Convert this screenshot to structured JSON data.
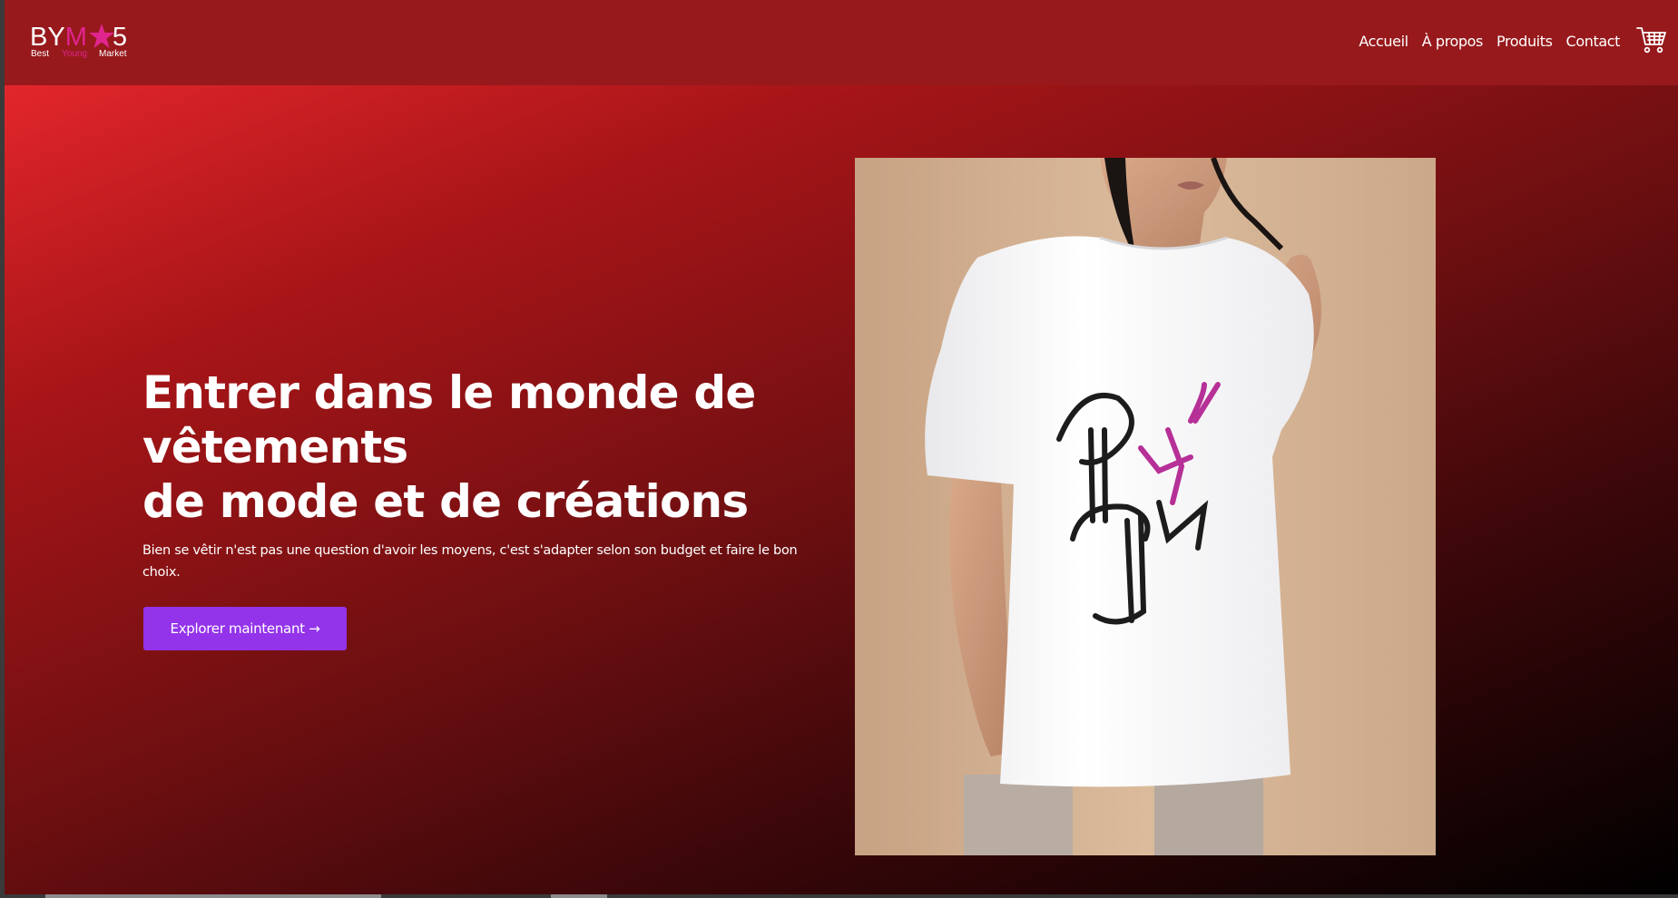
{
  "logo": {
    "main_prefix": "BY",
    "main_m": "M",
    "main_suffix": "5",
    "sub_best": "Best",
    "sub_young": "Young",
    "sub_market": "Market",
    "brand_pink": "#e0258f"
  },
  "nav": {
    "items": [
      {
        "label": "Accueil"
      },
      {
        "label": "À propos"
      },
      {
        "label": "Produits"
      },
      {
        "label": "Contact"
      }
    ],
    "cart_icon": "cart-icon"
  },
  "hero": {
    "title_line1": "Entrer dans le monde de",
    "title_line2": "vêtements",
    "title_line3": "de mode et de créations",
    "description": "Bien se vêtir n'est pas une question d'avoir les moyens, c'est s'adapter selon son budget et faire le bon choix.",
    "cta_label": "Explorer maintenant →",
    "image_icon": "model-tshirt-photo"
  },
  "colors": {
    "navbar": "#97191c",
    "accent_button": "#9333ea",
    "text": "#ffffff"
  }
}
